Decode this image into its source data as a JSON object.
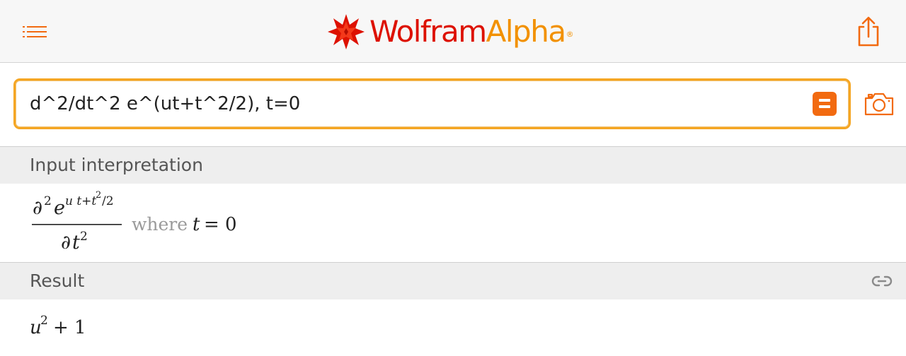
{
  "header": {
    "logo_wolfram": "Wolfram",
    "logo_alpha": "Alpha",
    "logo_reg": "®",
    "colors": {
      "wolfram_red": "#dd1100",
      "alpha_orange": "#f29100",
      "accent": "#f26a10"
    }
  },
  "search": {
    "query": "d^2/dt^2 e^(ut+t^2/2), t=0",
    "submit_icon": "equals-icon",
    "camera_icon": "camera-icon"
  },
  "pods": {
    "input": {
      "title": "Input interpretation",
      "num_partial": "∂",
      "num_power": "2",
      "num_e": "e",
      "exp_part1": "u t+t",
      "exp_power": "2",
      "exp_part2": "/2",
      "den_partial": "∂",
      "den_var": "t",
      "den_power": "2",
      "where": "where",
      "cond_var": "t",
      "cond_eq": "= 0"
    },
    "result": {
      "title": "Result",
      "var": "u",
      "power": "2",
      "rest": "+ 1",
      "link_icon": "link-icon"
    }
  }
}
